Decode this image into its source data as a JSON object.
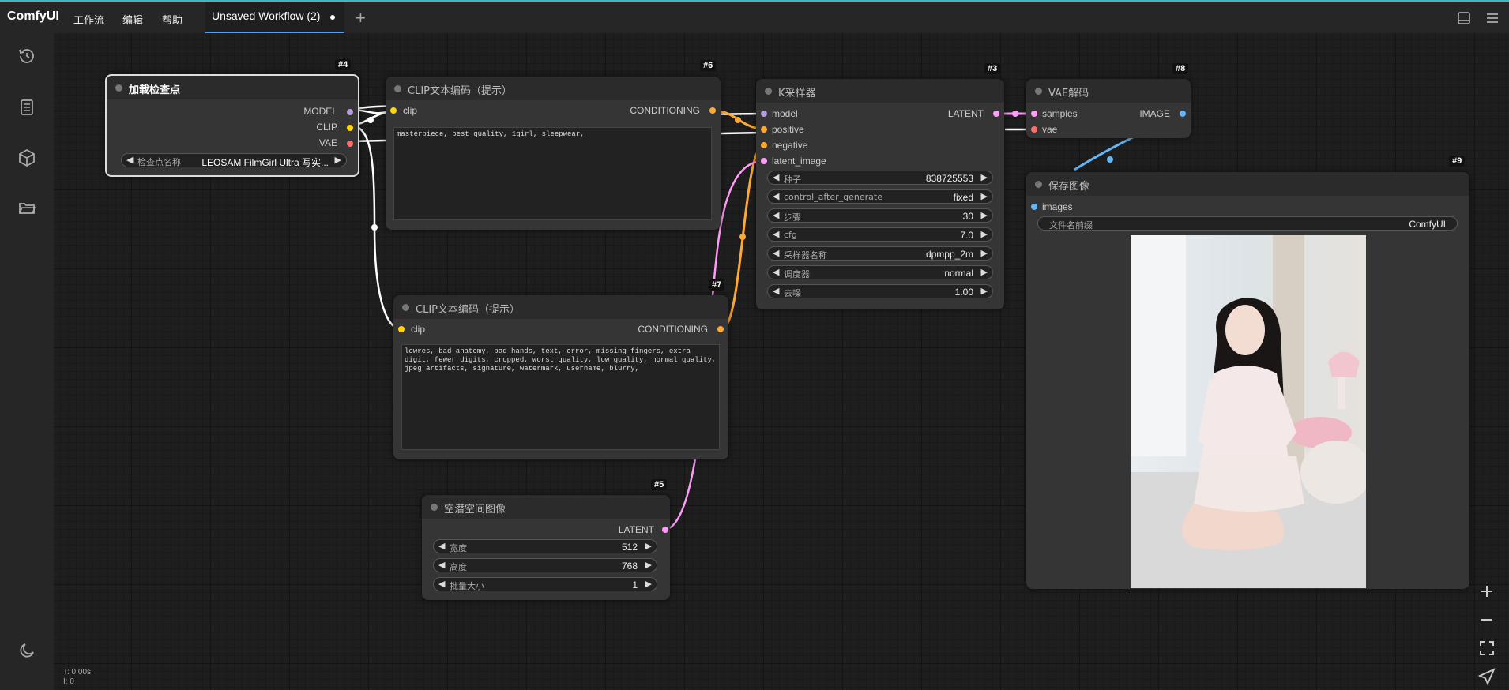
{
  "app": {
    "brand": "ComfyUI",
    "menus": [
      "工作流",
      "编辑",
      "帮助"
    ],
    "tab_title": "Unsaved Workflow (2)"
  },
  "sidebar": {
    "icons": [
      "history-icon",
      "queue-icon",
      "model-library-icon",
      "workflows-icon",
      "theme-toggle-icon"
    ]
  },
  "nodes": {
    "n4": {
      "id": "#4",
      "title": "加载检查点",
      "outputs": [
        "MODEL",
        "CLIP",
        "VAE"
      ],
      "widget_label": "检查点名称",
      "widget_value": "LEOSAM FilmGirl Ultra 写实..."
    },
    "n6": {
      "id": "#6",
      "title": "CLIP文本编码（提示）",
      "input": "clip",
      "output": "CONDITIONING",
      "text": "masterpiece, best quality, 1girl, sleepwear,"
    },
    "n7": {
      "id": "#7",
      "title": "CLIP文本编码（提示）",
      "input": "clip",
      "output": "CONDITIONING",
      "text": "lowres, bad anatomy, bad hands, text, error, missing fingers, extra digit, fewer digits, cropped, worst quality, low quality, normal quality, jpeg artifacts, signature, watermark, username, blurry,"
    },
    "n5": {
      "id": "#5",
      "title": "空潜空间图像",
      "output": "LATENT",
      "widgets": [
        {
          "label": "宽度",
          "value": "512"
        },
        {
          "label": "高度",
          "value": "768"
        },
        {
          "label": "批量大小",
          "value": "1"
        }
      ]
    },
    "n3": {
      "id": "#3",
      "title": "K采样器",
      "inputs": [
        "model",
        "positive",
        "negative",
        "latent_image"
      ],
      "output": "LATENT",
      "widgets": [
        {
          "label": "种子",
          "value": "838725553"
        },
        {
          "label": "control_after_generate",
          "value": "fixed"
        },
        {
          "label": "步骤",
          "value": "30"
        },
        {
          "label": "cfg",
          "value": "7.0"
        },
        {
          "label": "采样器名称",
          "value": "dpmpp_2m"
        },
        {
          "label": "调度器",
          "value": "normal"
        },
        {
          "label": "去噪",
          "value": "1.00"
        }
      ]
    },
    "n8": {
      "id": "#8",
      "title": "VAE解码",
      "inputs": [
        "samples",
        "vae"
      ],
      "output": "IMAGE"
    },
    "n9": {
      "id": "#9",
      "title": "保存图像",
      "input": "images",
      "widget_label": "文件名前缀",
      "widget_value": "ComfyUI"
    }
  },
  "status": {
    "time": "T: 0.00s",
    "count": "I: 0"
  },
  "colors": {
    "model": "#b39ddb",
    "clip": "#ffd500",
    "vae": "#ff6e6e",
    "conditioning": "#ffa931",
    "latent": "#ff9cf9",
    "image": "#64b5f6",
    "accent": "#4a9eff"
  }
}
